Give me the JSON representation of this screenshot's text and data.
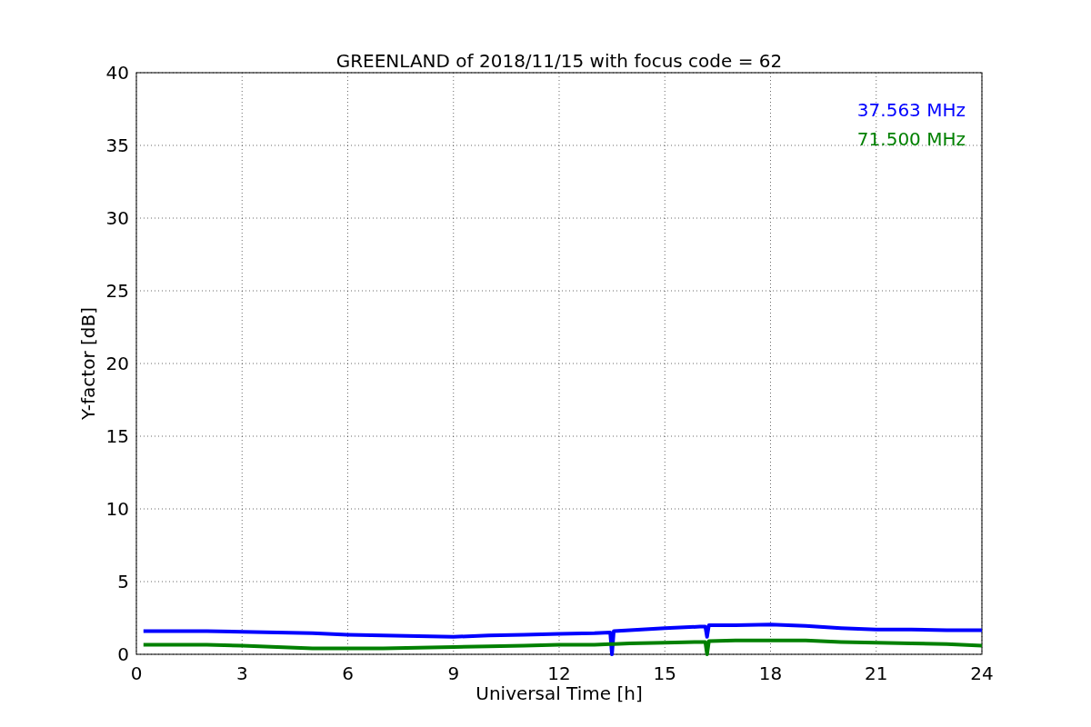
{
  "chart_data": {
    "type": "line",
    "title": "GREENLAND of 2018/11/15 with focus code = 62",
    "xlabel": "Universal Time [h]",
    "ylabel": "Y-factor [dB]",
    "x": [
      0.2,
      1,
      2,
      3,
      4,
      5,
      6,
      7,
      8,
      9,
      10,
      11,
      12,
      13,
      13.45,
      13.5,
      13.55,
      14,
      15,
      16,
      16.15,
      16.2,
      16.25,
      17,
      18,
      19,
      20,
      21,
      22,
      23,
      24
    ],
    "series": [
      {
        "name": "37.563 MHz",
        "color": "#0000ff",
        "values": [
          1.6,
          1.6,
          1.6,
          1.55,
          1.5,
          1.45,
          1.35,
          1.3,
          1.25,
          1.2,
          1.3,
          1.35,
          1.4,
          1.45,
          1.5,
          0,
          1.6,
          1.65,
          1.8,
          1.9,
          1.9,
          1.2,
          2.0,
          2.0,
          2.05,
          1.95,
          1.8,
          1.7,
          1.7,
          1.65,
          1.65
        ]
      },
      {
        "name": "71.500 MHz",
        "color": "#008000",
        "values": [
          0.65,
          0.65,
          0.65,
          0.6,
          0.5,
          0.4,
          0.4,
          0.4,
          0.45,
          0.5,
          0.55,
          0.6,
          0.65,
          0.65,
          0.7,
          0.7,
          0.7,
          0.75,
          0.8,
          0.85,
          0.85,
          0,
          0.9,
          0.95,
          0.95,
          0.95,
          0.85,
          0.8,
          0.75,
          0.7,
          0.6
        ]
      }
    ],
    "grid": true,
    "xlim": [
      0,
      24
    ],
    "ylim": [
      0,
      40
    ],
    "xticks": [
      0,
      3,
      6,
      9,
      12,
      15,
      18,
      21,
      24
    ],
    "yticks": [
      0,
      5,
      10,
      15,
      20,
      25,
      30,
      35,
      40
    ]
  }
}
